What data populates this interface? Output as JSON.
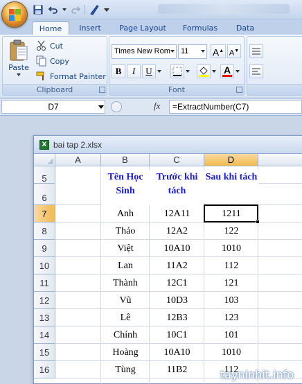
{
  "app": {
    "quick_access": [
      "save-icon",
      "undo-icon",
      "redo-icon",
      "format-painter-icon",
      "customize-icon"
    ]
  },
  "tabs": [
    "Home",
    "Insert",
    "Page Layout",
    "Formulas",
    "Data"
  ],
  "active_tab": "Home",
  "ribbon": {
    "clipboard": {
      "label": "Clipboard",
      "paste": "Paste",
      "cut": "Cut",
      "copy": "Copy",
      "format_painter": "Format Painter"
    },
    "font": {
      "label": "Font",
      "font_name": "Times New Rom",
      "font_size": "11",
      "grow": "A",
      "shrink": "A",
      "bold": "B",
      "italic": "I",
      "underline": "U",
      "font_color_letter": "A"
    }
  },
  "formula_bar": {
    "name_box": "D7",
    "fx": "fx",
    "formula": "=ExtractNumber(C7)"
  },
  "workbook": {
    "title": "bai tap 2.xlsx",
    "icon_letter": "X",
    "columns": [
      "A",
      "B",
      "C",
      "D"
    ],
    "selected_column": "D",
    "selected_row": "7",
    "rows": [
      "5",
      "6",
      "7",
      "8",
      "9",
      "10",
      "11",
      "12",
      "13",
      "14",
      "15",
      "16"
    ],
    "headers": {
      "b": "Tên Học Sinh",
      "c": "Trước khi tách",
      "d": "Sau khi tách"
    },
    "data": [
      {
        "name": "Anh",
        "before": "12A11",
        "after": "1211"
      },
      {
        "name": "Thảo",
        "before": "12A2",
        "after": "122"
      },
      {
        "name": "Việt",
        "before": "10A10",
        "after": "1010"
      },
      {
        "name": "Lan",
        "before": "11A2",
        "after": "112"
      },
      {
        "name": "Thành",
        "before": "12C1",
        "after": "121"
      },
      {
        "name": "Vũ",
        "before": "10D3",
        "after": "103"
      },
      {
        "name": "Lê",
        "before": "12B3",
        "after": "123"
      },
      {
        "name": "Chính",
        "before": "10C1",
        "after": "101"
      },
      {
        "name": "Hoàng",
        "before": "10A10",
        "after": "1010"
      },
      {
        "name": "Tùng",
        "before": "11B2",
        "after": "112"
      }
    ]
  },
  "watermark": "tayninhit.info",
  "colors": {
    "header_text": "#1a1adc",
    "selection_header": "#f1b952",
    "ribbon_text": "#15428b"
  }
}
